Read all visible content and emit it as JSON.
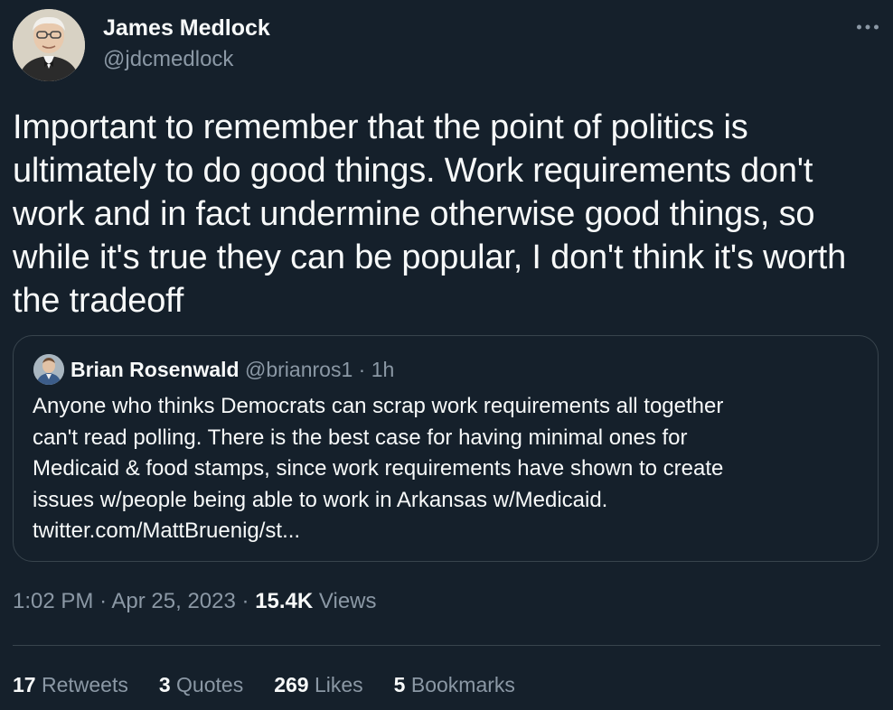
{
  "author": {
    "name": "James Medlock",
    "handle": "@jdcmedlock"
  },
  "tweet": {
    "text": "Important to remember that the point of politics is ultimately to do good things. Work requirements don't work and in fact undermine otherwise good things, so while it's true they can be popular, I don't think it's worth the tradeoff",
    "time": "1:02 PM",
    "date": "Apr 25, 2023",
    "views_count": "15.4K",
    "views_label": "Views"
  },
  "quoted_tweet": {
    "name": "Brian Rosenwald",
    "handle": "@brianros1",
    "age": "1h",
    "text_lines": [
      "Anyone who thinks Democrats can scrap work requirements all together",
      "can't read polling. There is the best case for having minimal ones for",
      "Medicaid & food stamps, since work requirements have shown to create",
      "issues w/people being able to work in Arkansas w/Medicaid.",
      "twitter.com/MattBruenig/st..."
    ]
  },
  "stats": {
    "retweets": {
      "count": "17",
      "label": "Retweets"
    },
    "quotes": {
      "count": "3",
      "label": "Quotes"
    },
    "likes": {
      "count": "269",
      "label": "Likes"
    },
    "bookmarks": {
      "count": "5",
      "label": "Bookmarks"
    }
  },
  "colors": {
    "background": "#15202b",
    "text": "#f7f9f9",
    "secondary_text": "#8b98a5",
    "border": "#38444d"
  },
  "icons": {
    "more": "more-horizontal-icon"
  }
}
